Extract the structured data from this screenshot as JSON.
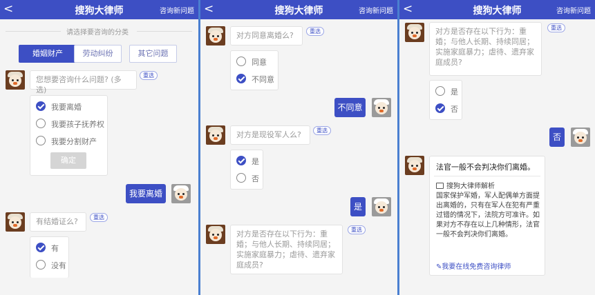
{
  "header": {
    "back": "<",
    "title": "搜狗大律师",
    "new_question": "咨询新问题"
  },
  "panel1": {
    "category_prompt": "请选择要咨询的分类",
    "categories": [
      "婚姻财产",
      "劳动纠纷",
      "其它问题"
    ],
    "q1": "您想要咨询什么问题? (多选)",
    "reselect": "重选",
    "q1_options": [
      "我要离婚",
      "我要孩子抚养权",
      "我要分割财产"
    ],
    "confirm": "确定",
    "user_answer1": "我要离婚",
    "q2": "有结婚证么?",
    "q2_options": [
      "有",
      "没有"
    ]
  },
  "panel2": {
    "q3": "对方同意离婚么?",
    "q3_options": [
      "同意",
      "不同意"
    ],
    "user_answer3": "不同意",
    "q4": "对方是现役军人么?",
    "q4_options": [
      "是",
      "否"
    ],
    "user_answer4": "是",
    "q5": "对方是否存在以下行为：重婚；与他人长期、持续同居；实施家庭暴力；虐待、遗弃家庭成员?"
  },
  "panel3": {
    "q5": "对方是否存在以下行为：重婚；与他人长期、持续同居；实施家庭暴力；虐待、遗弃家庭成员?",
    "q5_options": [
      "是",
      "否"
    ],
    "user_answer5": "否",
    "result_title": "法官一般不会判决你们离婚。",
    "analysis_label": "搜狗大律师解析",
    "analysis_text": "国家保护军婚，军人配偶单方面提出离婚的，只有在军人在犯有严重过错的情况下，法院方可准许。如果对方不存在以上几种情形，法官一般不会判决你们离婚。",
    "consult_link": "我要在线免费咨询律师"
  },
  "colors": {
    "accent": "#3d4fc4",
    "background": "#f4f4f4"
  }
}
